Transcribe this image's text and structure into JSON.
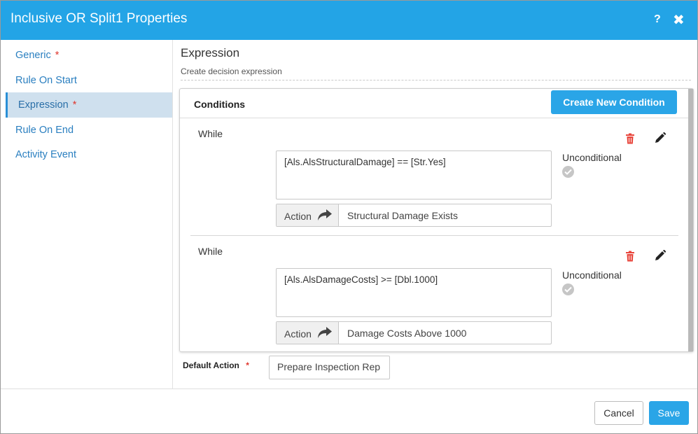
{
  "dialog": {
    "title": "Inclusive OR Split1 Properties",
    "help_glyph": "?",
    "close_glyph": "✖",
    "accent_color": "#23a4e6"
  },
  "sidebar": {
    "items": [
      {
        "label": "Generic",
        "required": "*",
        "active": false
      },
      {
        "label": "Rule On Start",
        "required": "",
        "active": false
      },
      {
        "label": "Expression",
        "required": "*",
        "active": true
      },
      {
        "label": "Rule On End",
        "required": "",
        "active": false
      },
      {
        "label": "Activity Event",
        "required": "",
        "active": false
      }
    ]
  },
  "section": {
    "title": "Expression",
    "subtitle": "Create decision expression"
  },
  "conditions": {
    "header": "Conditions",
    "create_button": "Create New Condition",
    "items": [
      {
        "while_label": "While",
        "expression": "[Als.AlsStructuralDamage] == [Str.Yes]",
        "unconditional_label": "Unconditional",
        "action_label": "Action",
        "action_value": "Structural Damage Exists",
        "delete_icon": "trash-icon",
        "edit_icon": "pencil-icon"
      },
      {
        "while_label": "While",
        "expression": "[Als.AlsDamageCosts] >= [Dbl.1000]",
        "unconditional_label": "Unconditional",
        "action_label": "Action",
        "action_value": "Damage Costs Above 1000",
        "delete_icon": "trash-icon",
        "edit_icon": "pencil-icon"
      }
    ]
  },
  "default_action": {
    "label": "Default Action",
    "required": "*",
    "value": "Prepare Inspection Rep"
  },
  "footer": {
    "cancel_label": "Cancel",
    "save_label": "Save"
  }
}
